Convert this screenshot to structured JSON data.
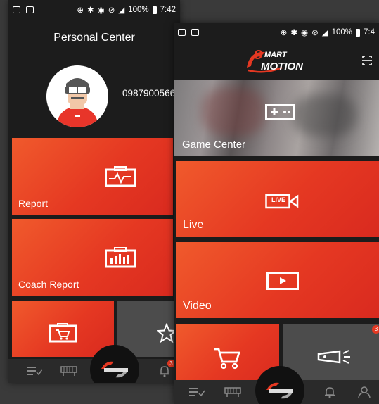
{
  "status_bar": {
    "battery": "100%",
    "time": "7:42"
  },
  "status_bar_right": {
    "battery": "100%",
    "time": "7:4"
  },
  "personal_center": {
    "title": "Personal Center",
    "phone_number": "0987900566",
    "tiles": [
      {
        "label": "Report",
        "icon": "chart-card-icon"
      },
      {
        "label": "Coach Report",
        "icon": "bar-chart-icon"
      },
      {
        "label": "",
        "icon": "shop-icon"
      },
      {
        "label": "",
        "icon": "star-icon"
      }
    ],
    "nav_badge": "3"
  },
  "home": {
    "brand": {
      "line1": "MART",
      "line2": "MOTION",
      "letter": "S"
    },
    "tiles": [
      {
        "label": "Game Center",
        "icon": "gamepad-icon"
      },
      {
        "label": "Live",
        "icon": "live-camera-icon",
        "badge": "LIVE"
      },
      {
        "label": "Video",
        "icon": "play-icon"
      },
      {
        "label": "",
        "icon": "cart-icon"
      },
      {
        "label": "",
        "icon": "projector-icon"
      }
    ],
    "badge": "3"
  },
  "colors": {
    "accent": "#e53822",
    "accent_light": "#f05a2c",
    "tile_grey": "#4c4c4c",
    "background": "#1c1c1c"
  }
}
